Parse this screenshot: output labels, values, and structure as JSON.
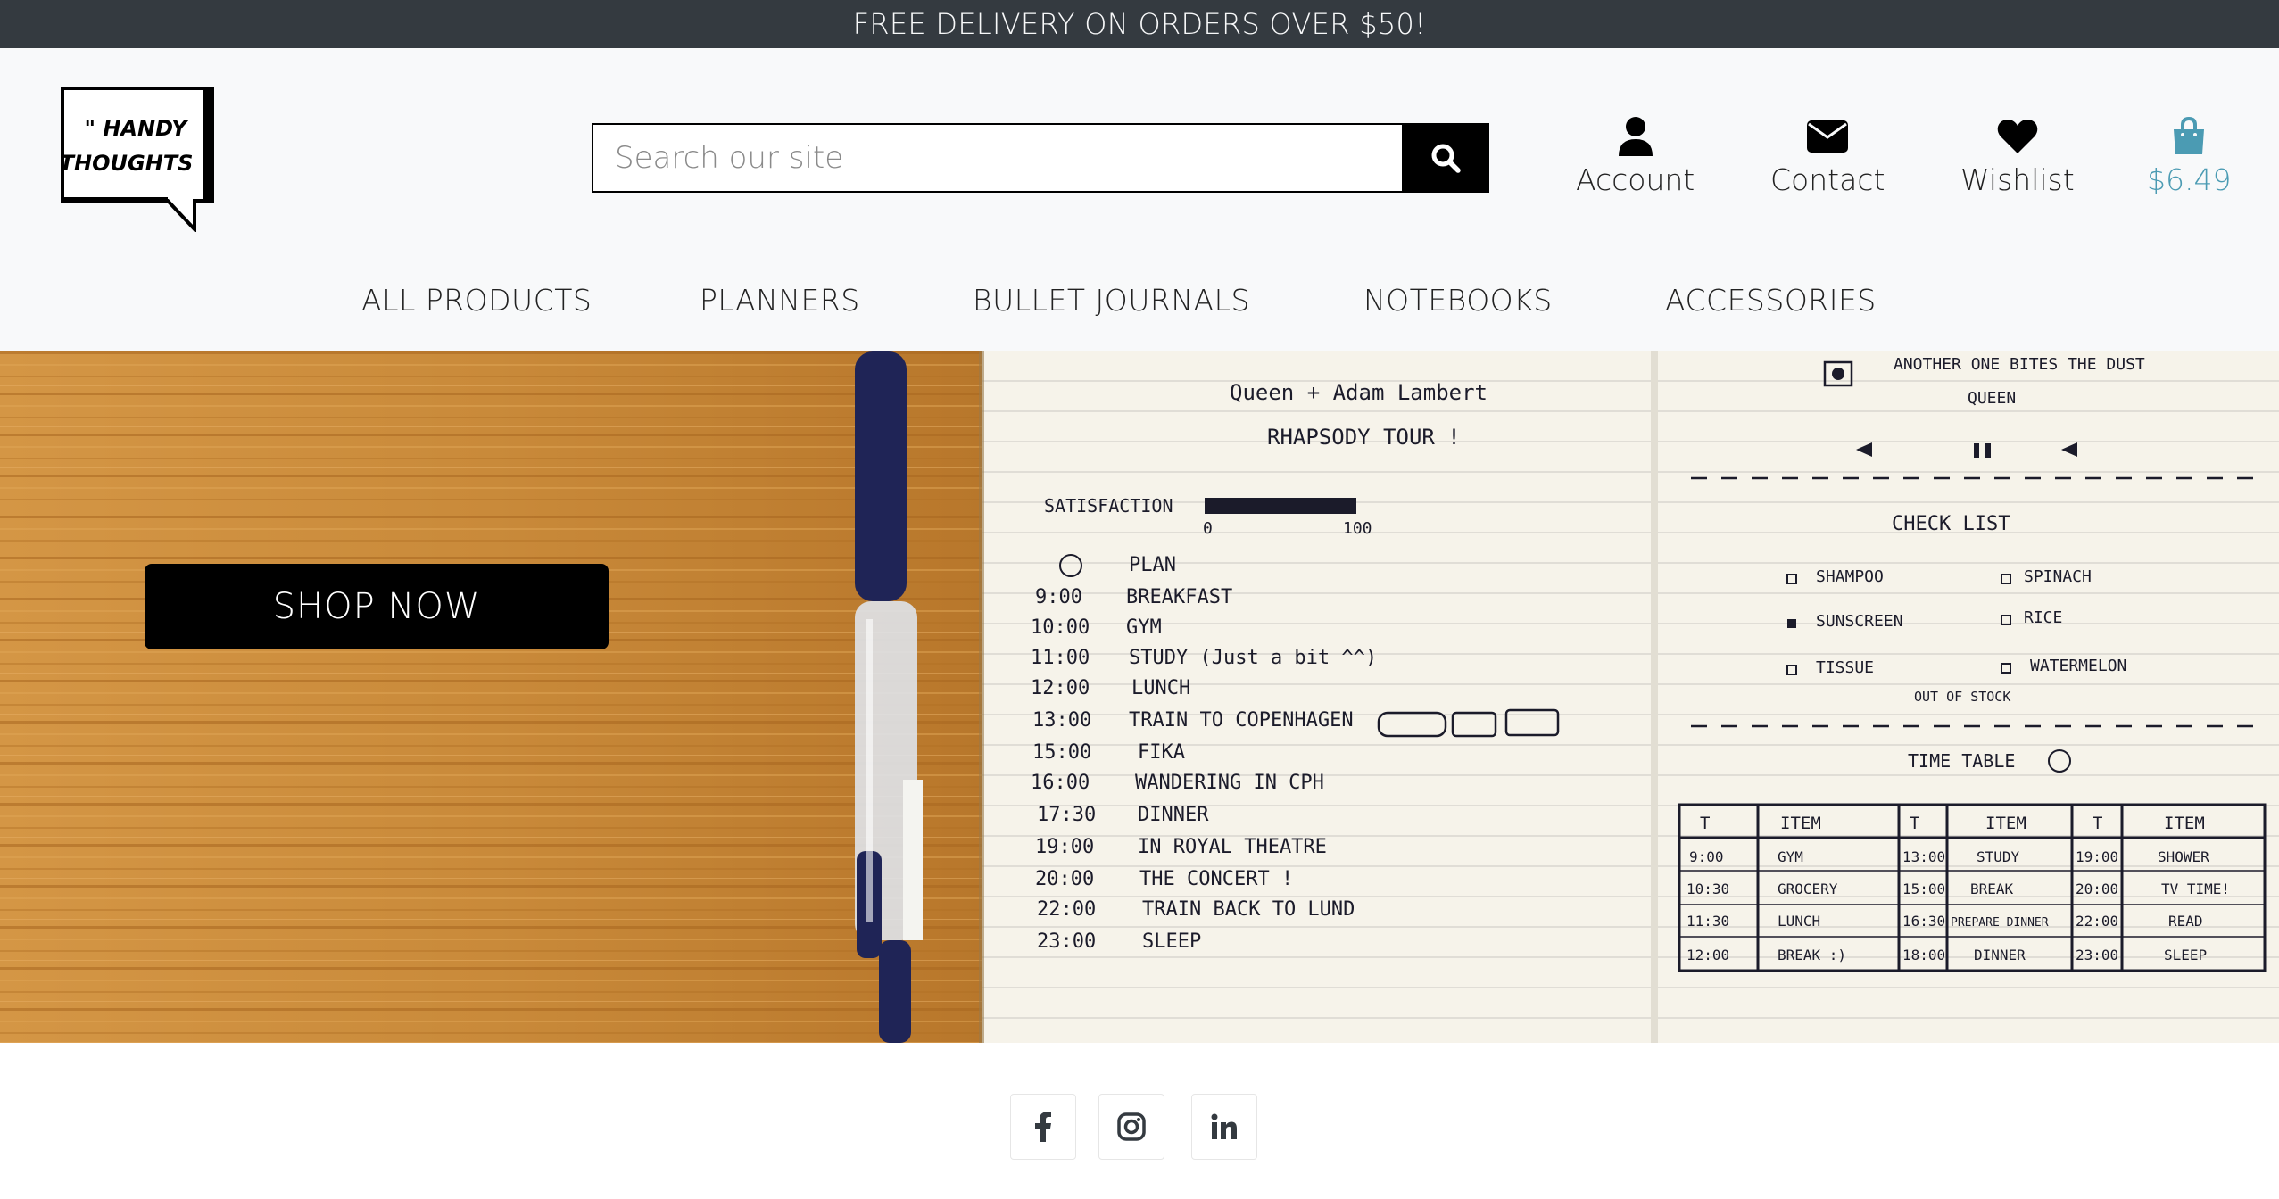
{
  "announcement": "FREE DELIVERY ON ORDERS OVER $50!",
  "logo": {
    "text_line1": "\" HANDY",
    "text_line2": "THOUGHTS \""
  },
  "search": {
    "placeholder": "Search our site",
    "icon": "search-icon"
  },
  "header_nav": [
    {
      "label": "Account",
      "icon": "user-icon"
    },
    {
      "label": "Contact",
      "icon": "envelope-icon"
    },
    {
      "label": "Wishlist",
      "icon": "heart-icon"
    },
    {
      "label": "$6.49",
      "icon": "shopping-bag-icon"
    }
  ],
  "menu": [
    "ALL PRODUCTS",
    "PLANNERS",
    "BULLET JOURNALS",
    "NOTEBOOKS",
    "ACCESSORIES"
  ],
  "hero": {
    "cta": "SHOP NOW",
    "journal_left_top": [
      "Queen + Adam Lambert",
      "RHAPSODY TOUR !"
    ],
    "satisfaction_label": "SATISFACTION",
    "satisfaction_scale": [
      "0",
      "100"
    ],
    "schedule": [
      {
        "time": "",
        "item": "PLAN"
      },
      {
        "time": "9:00",
        "item": "BREAKFAST"
      },
      {
        "time": "10:00",
        "item": "GYM"
      },
      {
        "time": "11:00",
        "item": "STUDY (Just a bit ^^)"
      },
      {
        "time": "12:00",
        "item": "LUNCH"
      },
      {
        "time": "13:00",
        "item": "TRAIN TO COPENHAGEN"
      },
      {
        "time": "15:00",
        "item": "FIKA"
      },
      {
        "time": "16:00",
        "item": "WANDERING IN CPH"
      },
      {
        "time": "17:30",
        "item": "DINNER"
      },
      {
        "time": "19:00",
        "item": "IN ROYAL THEATRE"
      },
      {
        "time": "20:00",
        "item": "THE CONCERT !"
      },
      {
        "time": "22:00",
        "item": "TRAIN BACK TO LUND"
      },
      {
        "time": "23:00",
        "item": "SLEEP"
      }
    ],
    "journal_right_top": [
      "ANOTHER ONE BITES THE DUST",
      "QUEEN"
    ],
    "checklist_title": "CHECK LIST",
    "checklist": [
      "SHAMPOO",
      "SPINACH",
      "SUNSCREEN",
      "RICE",
      "TISSUE",
      "WATERMELON"
    ],
    "checklist_note": "OUT OF STOCK",
    "timetable_title": "TIME TABLE",
    "timetable_header": [
      "T",
      "ITEM",
      "T",
      "ITEM",
      "T",
      "ITEM"
    ],
    "timetable_rows": [
      [
        "9:00",
        "GYM",
        "13:00",
        "STUDY",
        "19:00",
        "SHOWER"
      ],
      [
        "10:30",
        "GROCERY",
        "15:00",
        "BREAK",
        "20:00",
        "TV TIME!"
      ],
      [
        "11:30",
        "LUNCH",
        "16:30",
        "PREPARE DINNER",
        "22:00",
        "READ"
      ],
      [
        "12:00",
        "BREAK :)",
        "18:00",
        "DINNER",
        "23:00",
        "SLEEP"
      ]
    ]
  },
  "social": [
    {
      "name": "facebook",
      "icon": "facebook-icon"
    },
    {
      "name": "instagram",
      "icon": "instagram-icon"
    },
    {
      "name": "linkedin",
      "icon": "linkedin-icon"
    }
  ],
  "colors": {
    "topbar": "#343a40",
    "accent": "#4b9bb3",
    "page_bg": "#f8f9fa",
    "cta_bg": "#000000"
  }
}
